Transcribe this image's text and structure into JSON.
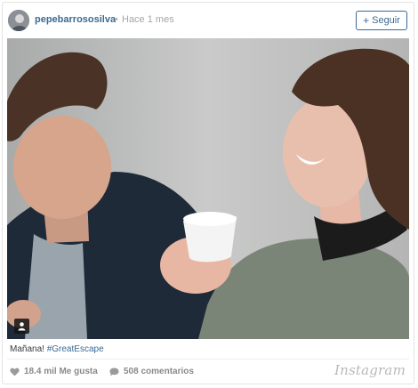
{
  "post": {
    "username": "pepebarrososilva",
    "separator": "•",
    "time": "Hace 1 mes",
    "follow_label": "Seguir",
    "follow_icon": "+"
  },
  "caption": {
    "text": "Mañana! ",
    "hashtag": "#GreatEscape"
  },
  "stats": {
    "likes": "18.4 mil Me gusta",
    "comments": "508 comentarios"
  },
  "brand": "Instagram",
  "colors": {
    "link": "#3a6a93",
    "muted": "#8a8a8a"
  }
}
